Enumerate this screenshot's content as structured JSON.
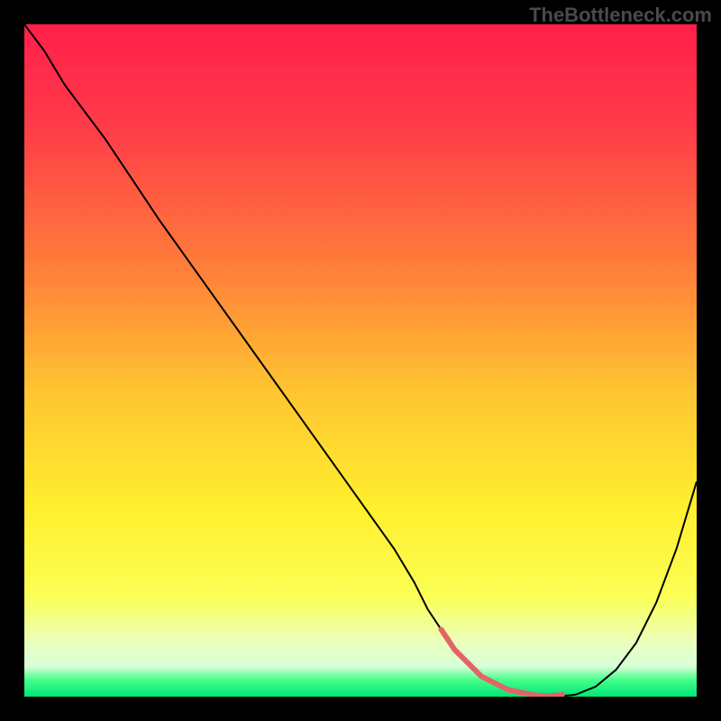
{
  "watermark": "TheBottleneck.com",
  "chart_data": {
    "type": "line",
    "title": "",
    "xlabel": "",
    "ylabel": "",
    "xlim": [
      0,
      100
    ],
    "ylim": [
      0,
      100
    ],
    "background_gradient": {
      "stops": [
        {
          "offset": 0.0,
          "color": "#ff1f4a"
        },
        {
          "offset": 0.15,
          "color": "#ff3b49"
        },
        {
          "offset": 0.35,
          "color": "#ff7a3a"
        },
        {
          "offset": 0.55,
          "color": "#ffc631"
        },
        {
          "offset": 0.72,
          "color": "#ffef2e"
        },
        {
          "offset": 0.85,
          "color": "#fbff55"
        },
        {
          "offset": 0.92,
          "color": "#eaffbe"
        },
        {
          "offset": 0.955,
          "color": "#d8ffd8"
        },
        {
          "offset": 0.975,
          "color": "#46ff8c"
        },
        {
          "offset": 1.0,
          "color": "#00e676"
        }
      ]
    },
    "series": [
      {
        "name": "bottleneck-curve",
        "color": "#000000",
        "x": [
          0,
          3,
          6,
          9,
          12,
          16,
          20,
          25,
          30,
          35,
          40,
          45,
          50,
          55,
          58,
          60,
          62,
          64,
          68,
          72,
          76,
          78,
          80,
          82,
          85,
          88,
          91,
          94,
          97,
          100
        ],
        "y": [
          100,
          96,
          91,
          87,
          83,
          77,
          71,
          64,
          57,
          50,
          43,
          36,
          29,
          22,
          17,
          13,
          10,
          7,
          3,
          1,
          0.2,
          0.1,
          0.1,
          0.3,
          1.5,
          4,
          8,
          14,
          22,
          32
        ]
      },
      {
        "name": "optimal-range-marker",
        "color": "#e06666",
        "stroke_width": 6,
        "x": [
          62,
          64,
          68,
          72,
          76,
          78,
          80
        ],
        "y": [
          10,
          7,
          3,
          1,
          0.2,
          0.1,
          0.3
        ]
      }
    ]
  }
}
